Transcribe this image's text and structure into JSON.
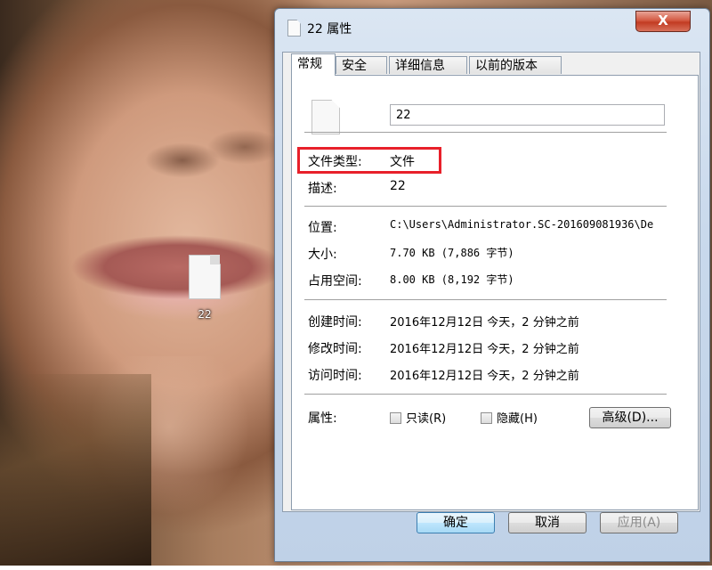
{
  "desktop": {
    "file_label": "22"
  },
  "window": {
    "title": "22 属性",
    "close_label": "X",
    "tabs": [
      {
        "label": "常规",
        "active": true
      },
      {
        "label": "安全",
        "active": false
      },
      {
        "label": "详细信息",
        "active": false
      },
      {
        "label": "以前的版本",
        "active": false
      }
    ],
    "name_value": "22",
    "type": {
      "key": "文件类型:",
      "value": "文件"
    },
    "description": {
      "key": "描述:",
      "value": "22"
    },
    "location": {
      "key": "位置:",
      "value": "C:\\Users\\Administrator.SC-201609081936\\De"
    },
    "size": {
      "key": "大小:",
      "value": "7.70 KB (7,886 字节)"
    },
    "size_on_disk": {
      "key": "占用空间:",
      "value": "8.00 KB (8,192 字节)"
    },
    "created": {
      "key": "创建时间:",
      "value": "2016年12月12日 今天，2 分钟之前"
    },
    "modified": {
      "key": "修改时间:",
      "value": "2016年12月12日 今天，2 分钟之前"
    },
    "accessed": {
      "key": "访问时间:",
      "value": "2016年12月12日 今天，2 分钟之前"
    },
    "attributes": {
      "key": "属性:",
      "readonly_label": "只读(R)",
      "readonly_checked": false,
      "hidden_label": "隐藏(H)",
      "hidden_checked": false,
      "advanced_label": "高级(D)..."
    },
    "buttons": {
      "ok": "确定",
      "cancel": "取消",
      "apply": "应用(A)"
    }
  },
  "colors": {
    "highlight_border": "#e8202a",
    "ok_button_border": "#3c7fb1",
    "close_button": "#c23b22"
  }
}
